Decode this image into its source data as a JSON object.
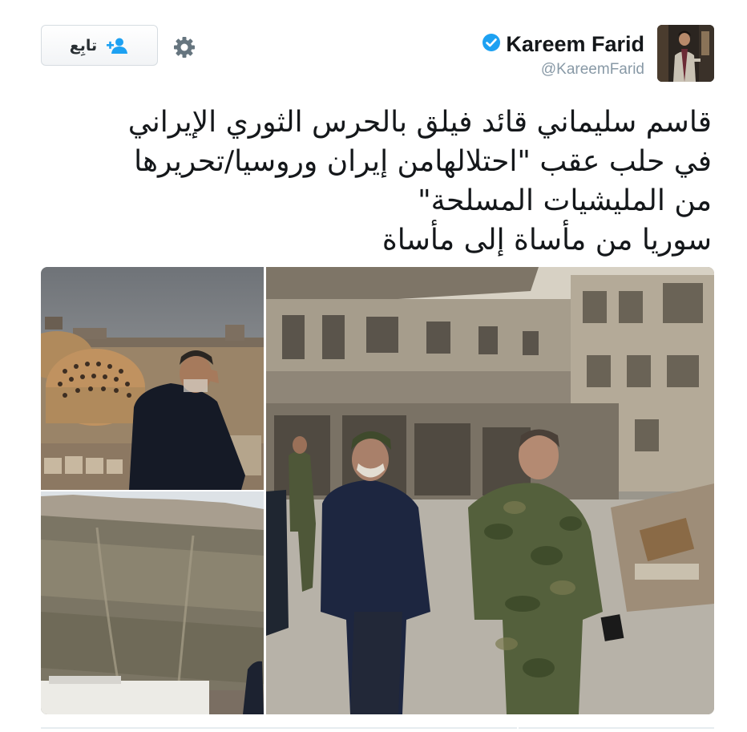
{
  "header": {
    "follow_label": "تابِع",
    "display_name": "Kareem Farid",
    "handle": "@KareemFarid",
    "verified": true
  },
  "tweet": {
    "lines": [
      "قاسم سليماني قائد فيلق بالحرس الثوري الإيراني",
      "في حلب عقب \"احتلالهامن إيران وروسيا/تحريرها",
      "من المليشيات المسلحة\"",
      "سوريا من مأساة إلى مأساة"
    ]
  },
  "media": {
    "photos": [
      "dome-photo",
      "citadel-photo",
      "street-photo"
    ]
  },
  "icons": {
    "follow": "add-user-icon",
    "settings": "gear-icon",
    "verified": "verified-badge-icon"
  },
  "colors": {
    "brand_blue": "#1da1f2",
    "text": "#14171a",
    "muted": "#8899a6",
    "border": "#d6dce1"
  }
}
